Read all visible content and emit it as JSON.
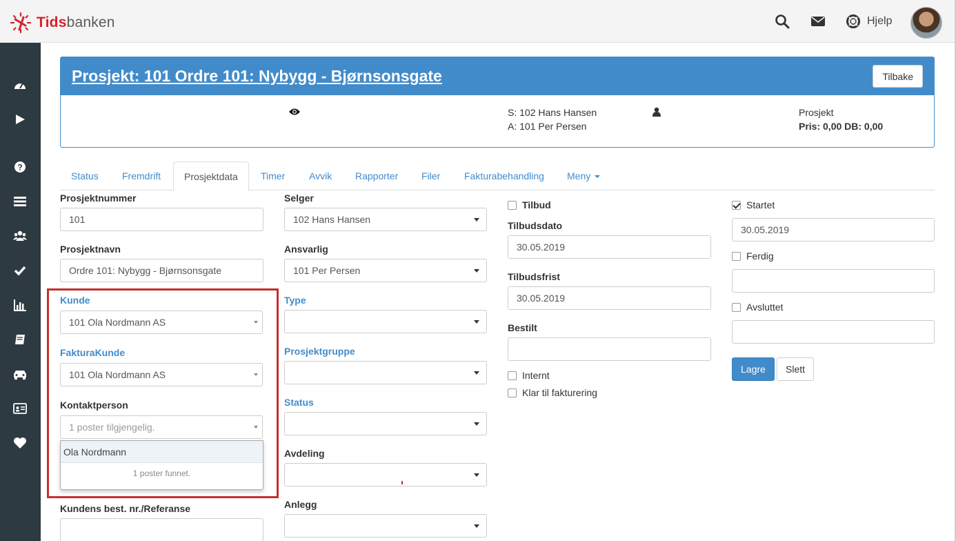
{
  "brand": {
    "part1": "Tids",
    "part2": "banken"
  },
  "topbar": {
    "help_label": "Hjelp"
  },
  "panel": {
    "title": "Prosjekt: 101 Ordre 101: Nybygg - Bjørnsonsgate",
    "back_button": "Tilbake",
    "seller_line": "S: 102 Hans Hansen",
    "responsible_line": "A: 101 Per Persen",
    "type_label": "Prosjekt",
    "price_line": "Pris: 0,00 DB: 0,00"
  },
  "tabs": [
    "Status",
    "Fremdrift",
    "Prosjektdata",
    "Timer",
    "Avvik",
    "Rapporter",
    "Filer",
    "Fakturabehandling",
    "Meny"
  ],
  "form": {
    "prosjektnummer": {
      "label": "Prosjektnummer",
      "value": "101"
    },
    "prosjektnavn": {
      "label": "Prosjektnavn",
      "value": "Ordre 101: Nybygg - Bjørnsonsgate"
    },
    "kunde": {
      "label": "Kunde",
      "value": "101 Ola Nordmann AS"
    },
    "fakturakunde": {
      "label": "FakturaKunde",
      "value": "101 Ola Nordmann AS"
    },
    "kontaktperson": {
      "label": "Kontaktperson",
      "placeholder": "1 poster tilgjengelig."
    },
    "kontaktperson_dropdown": {
      "option": "Ola Nordmann",
      "footer": "1 poster funnet."
    },
    "kundens_ref": {
      "label": "Kundens best. nr./Referanse",
      "value": ""
    },
    "selger": {
      "label": "Selger",
      "value": "102 Hans Hansen"
    },
    "ansvarlig": {
      "label": "Ansvarlig",
      "value": "101 Per Persen"
    },
    "type": {
      "label": "Type",
      "value": ""
    },
    "prosjektgruppe": {
      "label": "Prosjektgruppe",
      "value": ""
    },
    "status": {
      "label": "Status",
      "value": ""
    },
    "avdeling": {
      "label": "Avdeling",
      "value": ""
    },
    "anlegg": {
      "label": "Anlegg",
      "value": ""
    },
    "tilbud": {
      "label": "Tilbud",
      "checked": false
    },
    "tilbudsdato": {
      "label": "Tilbudsdato",
      "value": "30.05.2019"
    },
    "tilbudsfrist": {
      "label": "Tilbudsfrist",
      "value": "30.05.2019"
    },
    "bestilt": {
      "label": "Bestilt",
      "value": ""
    },
    "internt": {
      "label": "Internt",
      "checked": false
    },
    "klar": {
      "label": "Klar til fakturering",
      "checked": false
    },
    "startet": {
      "label": "Startet",
      "checked": true,
      "value": "30.05.2019"
    },
    "ferdig": {
      "label": "Ferdig",
      "checked": false,
      "value": ""
    },
    "avsluttet": {
      "label": "Avsluttet",
      "checked": false,
      "value": ""
    },
    "save_button": "Lagre",
    "delete_button": "Slett"
  },
  "colors": {
    "primary": "#428bca",
    "sidebar": "#2d3a42",
    "brand_red": "#d7232b",
    "highlight": "#c4302b"
  }
}
